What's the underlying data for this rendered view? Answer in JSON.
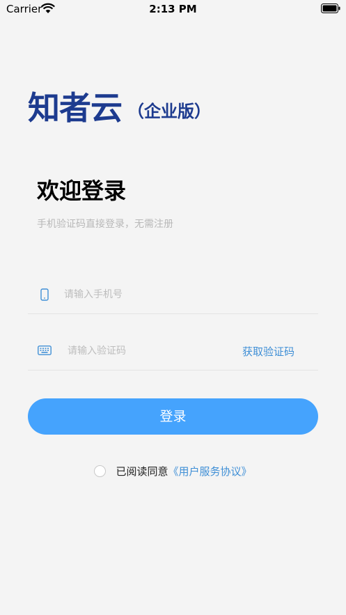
{
  "status_bar": {
    "carrier": "Carrier",
    "time": "2:13 PM",
    "icons": [
      "wifi-icon",
      "battery-icon"
    ]
  },
  "logo": {
    "name": "知者云",
    "edition": "（企业版）",
    "color": "#1d3b8f"
  },
  "welcome": {
    "title": "欢迎登录",
    "subtitle": "手机验证码直接登录，无需注册"
  },
  "form": {
    "phone": {
      "icon": "mobile-phone-icon",
      "value": "",
      "placeholder": "请输入手机号"
    },
    "code": {
      "icon": "keyboard-icon",
      "value": "",
      "placeholder": "请输入验证码",
      "get_code_label": "获取验证码"
    },
    "login_label": "登录"
  },
  "agreement": {
    "checked": false,
    "text": "已阅读同意",
    "link_text": "《用户服务协议》"
  },
  "colors": {
    "accent": "#45a3fd",
    "link": "#3f8fd6",
    "background": "#f4f4f4"
  }
}
